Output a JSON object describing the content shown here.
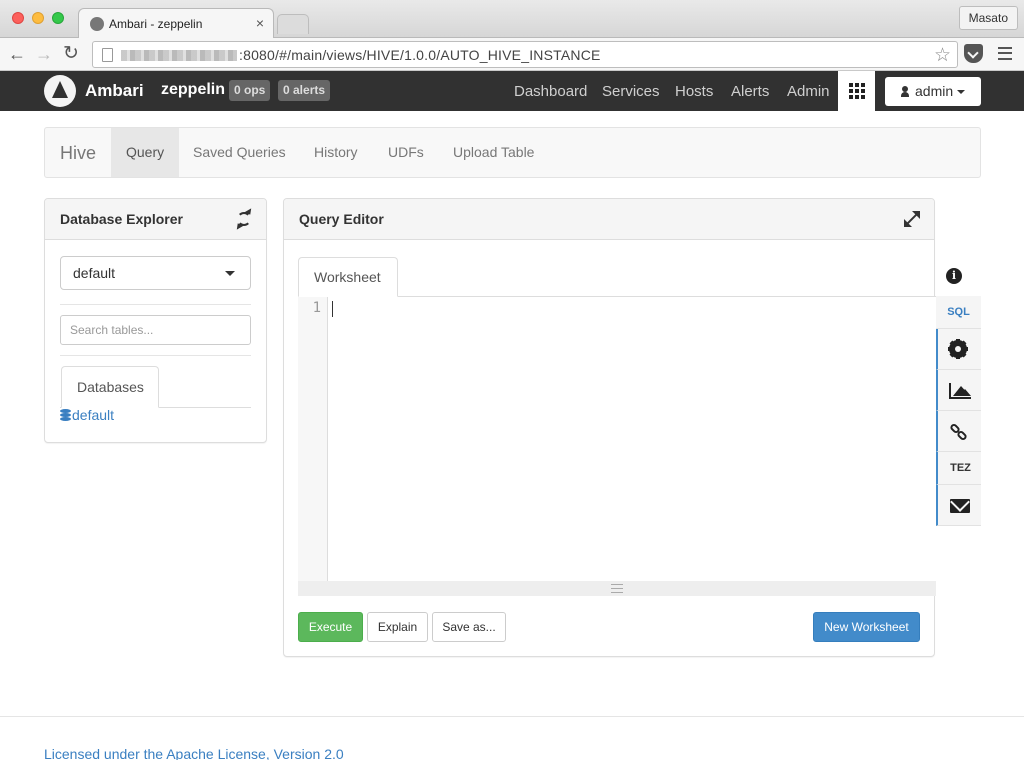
{
  "browser": {
    "tab_title": "Ambari - zeppelin",
    "tab_close": "×",
    "profile_name": "Masato",
    "url": ":8080/#/main/views/HIVE/1.0.0/AUTO_HIVE_INSTANCE",
    "nav_back": "←",
    "nav_forward": "→",
    "nav_reload": "↻",
    "bookmark_star": "☆"
  },
  "topnav": {
    "brand": "Ambari",
    "cluster": "zeppelin",
    "ops_badge": "0 ops",
    "alerts_badge": "0 alerts",
    "links": [
      "Dashboard",
      "Services",
      "Hosts",
      "Alerts",
      "Admin"
    ],
    "user": "admin"
  },
  "subnav": {
    "brand": "Hive",
    "items": [
      "Query",
      "Saved Queries",
      "History",
      "UDFs",
      "Upload Table"
    ],
    "active": "Query"
  },
  "db_explorer": {
    "title": "Database Explorer",
    "selected_db": "default",
    "search_placeholder": "Search tables...",
    "tab_label": "Databases",
    "databases": [
      "default"
    ]
  },
  "query_editor": {
    "title": "Query Editor",
    "worksheet_tab": "Worksheet",
    "line_numbers": [
      "1"
    ],
    "buttons": {
      "execute": "Execute",
      "explain": "Explain",
      "save_as": "Save as...",
      "new_worksheet": "New Worksheet"
    }
  },
  "side_toolbar": {
    "info_glyph": "i",
    "sql_label": "SQL",
    "tez_label": "TEZ",
    "icons": [
      "info-icon",
      "sql",
      "gear-icon",
      "chart-icon",
      "link-icon",
      "tez",
      "mail-icon"
    ]
  },
  "colors": {
    "execute_green": "#5cb85c",
    "primary_blue": "#428bca",
    "link_blue": "#3a7fc1",
    "topnav_bg": "#313131"
  },
  "footer": {
    "license_link": "Licensed under the Apache License, Version 2.0"
  }
}
